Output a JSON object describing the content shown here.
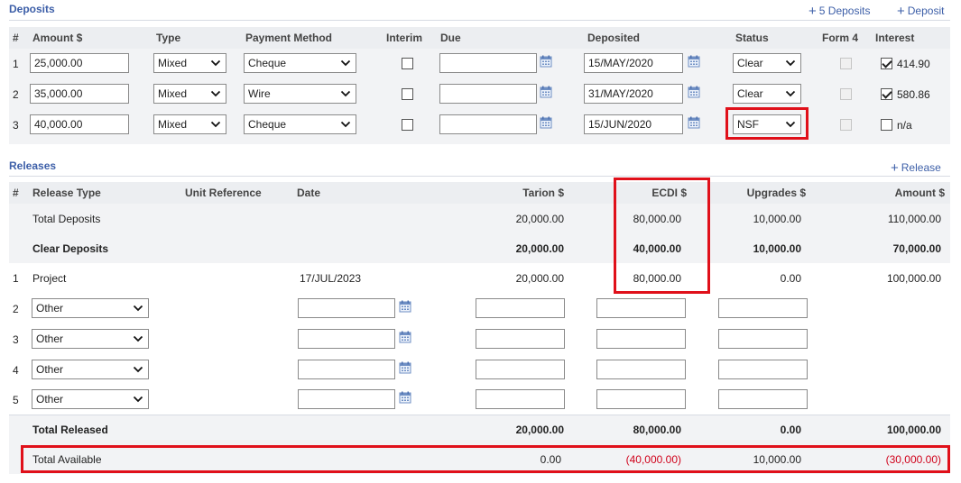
{
  "deposits": {
    "title": "Deposits",
    "add_five_label": "5 Deposits",
    "add_one_label": "Deposit",
    "columns": [
      "#",
      "Amount $",
      "Type",
      "Payment Method",
      "Interim",
      "Due",
      "Deposited",
      "Status",
      "Form 4",
      "Interest"
    ],
    "rows": [
      {
        "num": "1",
        "amount": "25,000.00",
        "type": "Mixed",
        "method": "Cheque",
        "due": "",
        "deposited": "15/MAY/2020",
        "status": "Clear",
        "interest_checked": true,
        "interest": "414.90"
      },
      {
        "num": "2",
        "amount": "35,000.00",
        "type": "Mixed",
        "method": "Wire",
        "due": "",
        "deposited": "31/MAY/2020",
        "status": "Clear",
        "interest_checked": true,
        "interest": "580.86"
      },
      {
        "num": "3",
        "amount": "40,000.00",
        "type": "Mixed",
        "method": "Cheque",
        "due": "",
        "deposited": "15/JUN/2020",
        "status": "NSF",
        "interest_checked": false,
        "interest": "n/a"
      }
    ]
  },
  "releases": {
    "title": "Releases",
    "add_label": "Release",
    "columns": [
      "#",
      "Release Type",
      "Unit Reference",
      "Date",
      "Tarion $",
      "ECDI $",
      "Upgrades $",
      "Amount $"
    ],
    "total_deposits": {
      "label": "Total Deposits",
      "tarion": "20,000.00",
      "ecdi": "80,000.00",
      "upgrades": "10,000.00",
      "amount": "110,000.00"
    },
    "clear_deposits": {
      "label": "Clear Deposits",
      "tarion": "20,000.00",
      "ecdi": "40,000.00",
      "upgrades": "10,000.00",
      "amount": "70,000.00"
    },
    "project": {
      "num": "1",
      "type": "Project",
      "date": "17/JUL/2023",
      "tarion": "20,000.00",
      "ecdi": "80,000.00",
      "upgrades": "0.00",
      "amount": "100,000.00"
    },
    "other_rows": [
      {
        "num": "2",
        "type": "Other"
      },
      {
        "num": "3",
        "type": "Other"
      },
      {
        "num": "4",
        "type": "Other"
      },
      {
        "num": "5",
        "type": "Other"
      }
    ],
    "total_released": {
      "label": "Total Released",
      "tarion": "20,000.00",
      "ecdi": "80,000.00",
      "upgrades": "0.00",
      "amount": "100,000.00"
    },
    "total_available": {
      "label": "Total Available",
      "tarion": "0.00",
      "ecdi": "(40,000.00)",
      "upgrades": "10,000.00",
      "amount": "(30,000.00)"
    }
  },
  "colors": {
    "accent": "#3d5fa8",
    "highlight": "#e0101a",
    "negative": "#d0021b"
  }
}
